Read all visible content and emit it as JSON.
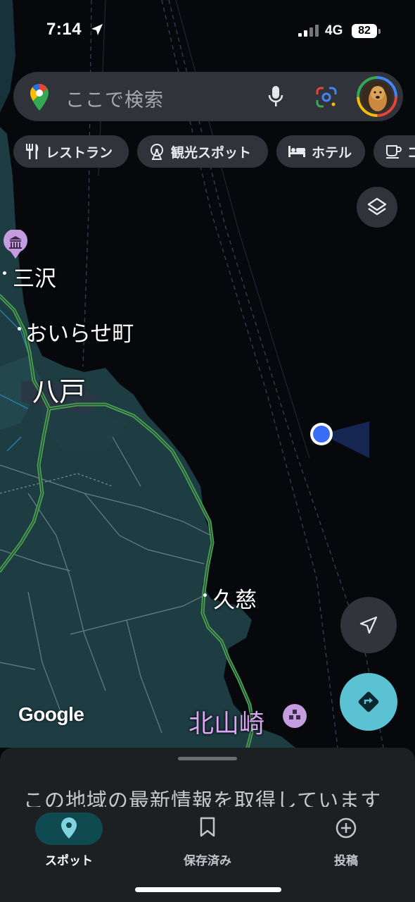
{
  "status_bar": {
    "time": "7:14",
    "network": "4G",
    "battery": "82"
  },
  "search": {
    "placeholder": "ここで検索"
  },
  "chips": [
    {
      "label": "レストラン",
      "icon": "restaurant-icon"
    },
    {
      "label": "観光スポット",
      "icon": "ferris-wheel-icon"
    },
    {
      "label": "ホテル",
      "icon": "bed-icon"
    },
    {
      "label": "コ",
      "icon": "coffee-icon"
    }
  ],
  "map": {
    "places": {
      "misawa": "三沢",
      "oirase": "おいらせ町",
      "hachinohe": "八戸",
      "kuji": "久慈",
      "kitayamazaki": "北山崎"
    },
    "attribution": "Google",
    "colors": {
      "land": "#1d3a3e",
      "sea": "#07080c",
      "highway": "#4a9e4c",
      "poi": "#c59ce0",
      "my_location": "#3b6cf5"
    }
  },
  "sheet": {
    "message": "この地域の最新情報を取得しています"
  },
  "bottom_nav": [
    {
      "label": "スポット",
      "icon": "location-pin-icon",
      "active": true
    },
    {
      "label": "保存済み",
      "icon": "bookmark-icon",
      "active": false
    },
    {
      "label": "投稿",
      "icon": "add-circle-icon",
      "active": false
    }
  ]
}
